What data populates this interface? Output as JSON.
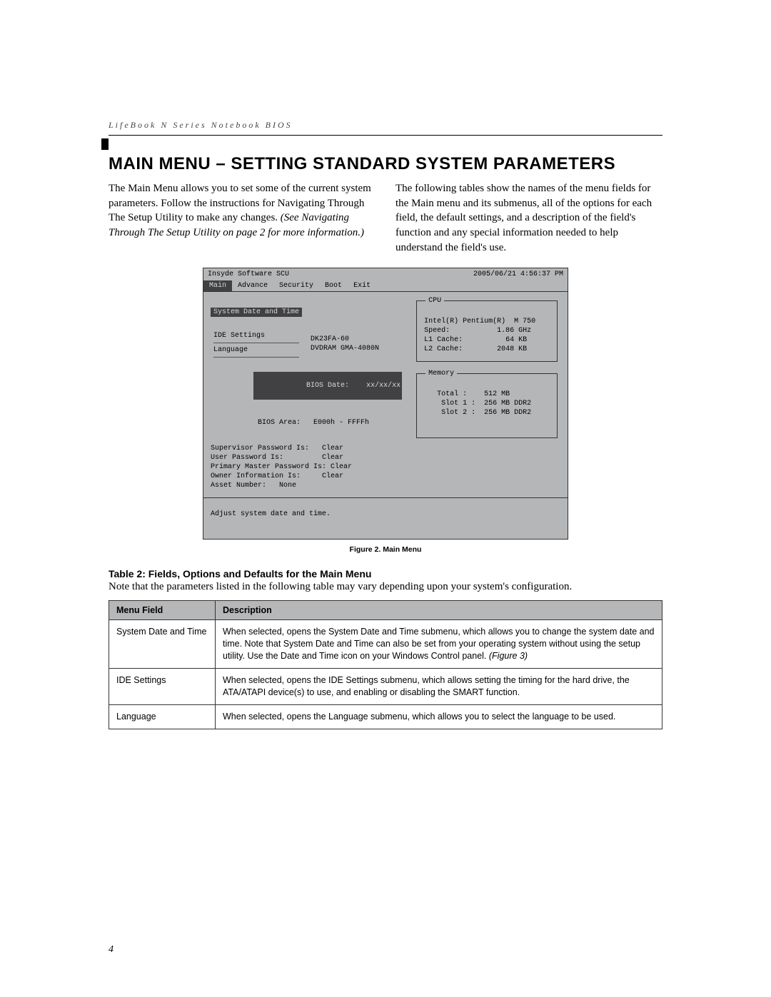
{
  "header": {
    "running_head": "LifeBook N Series Notebook BIOS"
  },
  "title": "MAIN MENU – SETTING STANDARD SYSTEM PARAMETERS",
  "intro": {
    "left_plain": "The Main Menu allows you to set some of the current system parameters. Follow the instructions for Navigating Through The Setup Utility to make any changes. ",
    "left_italic": "(See Navigating Through The Setup Utility on page 2 for more information.)",
    "right": "The following tables show the names of the menu fields for the Main menu and its submenus, all of the options for each field, the default settings, and a description of the field's function and any special information needed to help understand the field's use."
  },
  "bios": {
    "title": "Insyde Software SCU",
    "datetime": "2005/06/21  4:56:37  PM",
    "tabs": [
      "Main",
      "Advance",
      "Security",
      "Boot",
      "Exit"
    ],
    "left": {
      "selected": "System Date and Time",
      "items": [
        "IDE Settings",
        "Language"
      ],
      "ide_values": "DK23FA-60\nDVDRAM GMA-4080N",
      "bios_date_label": "BIOS Date:",
      "bios_date_value": "xx/xx/xx",
      "bios_area_label": "BIOS Area:",
      "bios_area_value": "E000h - FFFFh",
      "pw_lines": [
        "Supervisor Password Is:   Clear",
        "User Password Is:         Clear",
        "Primary Master Password Is: Clear",
        "",
        "Owner Information Is:     Clear",
        "Asset Number:   None"
      ]
    },
    "cpu": {
      "legend": "CPU",
      "lines": [
        "Intel(R) Pentium(R)  M 750",
        "Speed:           1.86 GHz",
        "L1 Cache:          64 KB",
        "L2 Cache:        2048 KB"
      ]
    },
    "memory": {
      "legend": "Memory",
      "lines": [
        "   Total :    512 MB",
        "    Slot 1 :  256 MB DDR2",
        "    Slot 2 :  256 MB DDR2"
      ]
    },
    "help": "Adjust system date and time."
  },
  "figure_caption": "Figure 2.   Main Menu",
  "table": {
    "caption": "Table 2: Fields, Options and Defaults for the Main Menu",
    "note": "Note that the parameters listed in the following table may vary depending upon your system's configuration.",
    "headers": [
      "Menu Field",
      "Description"
    ],
    "rows": [
      {
        "field": "System Date and Time",
        "desc_plain": "When selected, opens the System Date and Time submenu, which allows you to change the system date and time. Note that System Date and Time can also be set from your operating system without using the setup utility. Use the Date and Time icon on your Windows Control panel. ",
        "desc_italic": "(Figure 3)"
      },
      {
        "field": "IDE Settings",
        "desc_plain": "When selected, opens the IDE Settings submenu, which allows setting the timing for the hard drive, the ATA/ATAPI device(s) to use, and enabling or disabling the SMART function.",
        "desc_italic": ""
      },
      {
        "field": "Language",
        "desc_plain": "When selected, opens the Language submenu, which allows you to select the language to be used.",
        "desc_italic": ""
      }
    ]
  },
  "page_number": "4"
}
